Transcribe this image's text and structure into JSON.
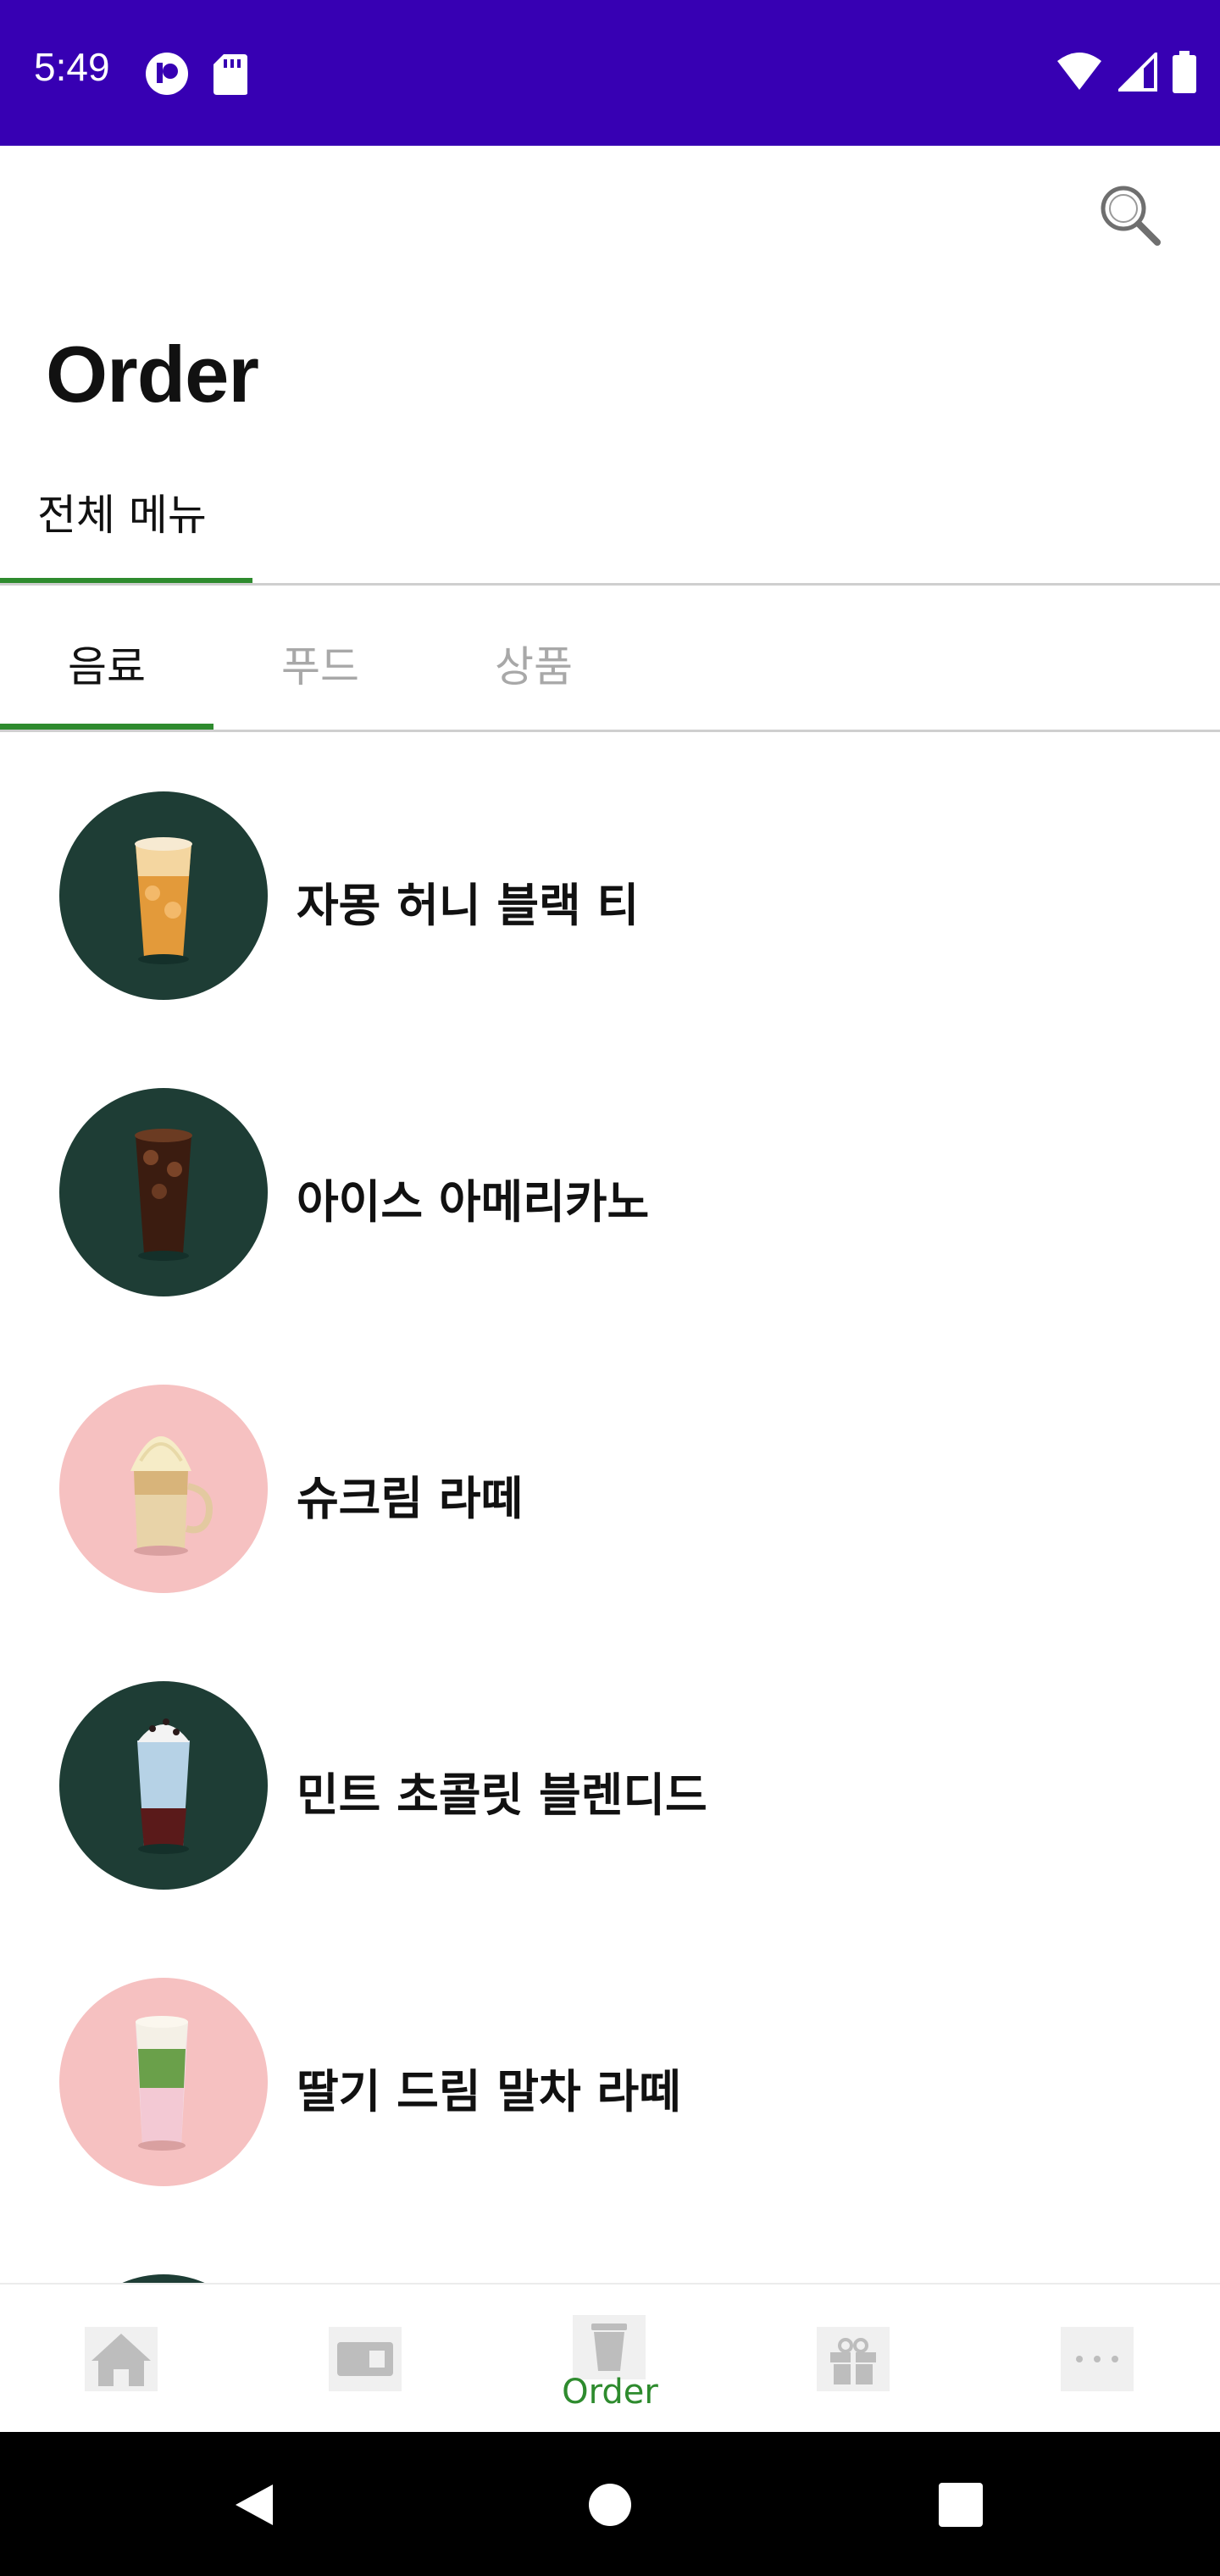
{
  "status_bar": {
    "time": "5:49"
  },
  "header": {
    "title": "Order"
  },
  "top_tabs": [
    {
      "label": "전체 메뉴"
    }
  ],
  "category_tabs": [
    {
      "label": "음료",
      "active": true
    },
    {
      "label": "푸드",
      "active": false
    },
    {
      "label": "상품",
      "active": false
    }
  ],
  "menu_items": [
    {
      "name": "자몽 허니 블랙 티",
      "thumb_bg": "#1e3d35"
    },
    {
      "name": "아이스 아메리카노",
      "thumb_bg": "#1e3d35"
    },
    {
      "name": "슈크림 라떼",
      "thumb_bg": "#f6c1c1"
    },
    {
      "name": "민트 초콜릿 블렌디드",
      "thumb_bg": "#1e3d35"
    },
    {
      "name": "딸기 드림 말차 라떼",
      "thumb_bg": "#f6c1c1"
    }
  ],
  "bottom_nav": {
    "items": [
      {
        "icon": "home-icon"
      },
      {
        "icon": "wallet-card-icon"
      },
      {
        "icon": "cup-icon",
        "label": "Order"
      },
      {
        "icon": "gift-icon"
      },
      {
        "icon": "more-icon"
      }
    ]
  },
  "colors": {
    "status_bar": "#3700b3",
    "accent_green": "#2e8b2e"
  }
}
